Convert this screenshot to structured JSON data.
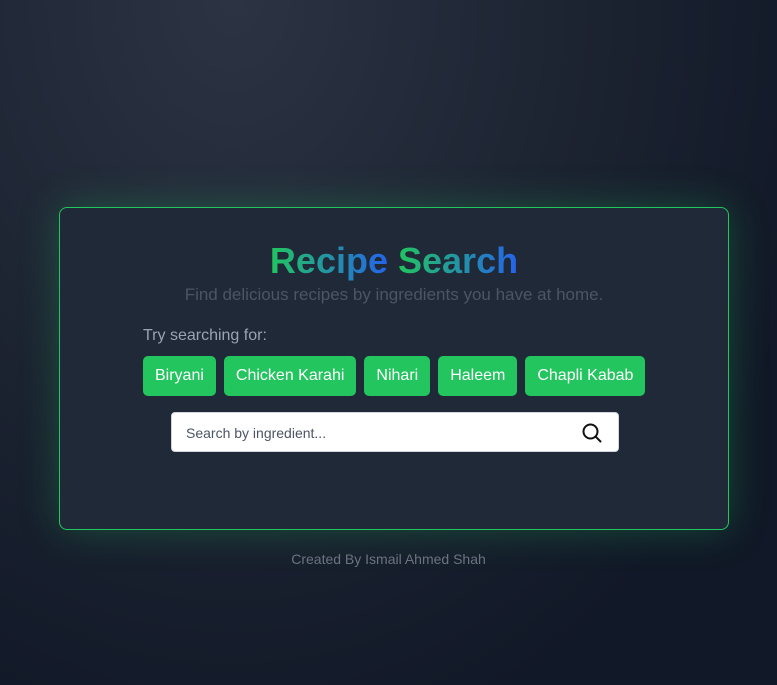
{
  "app": {
    "title_part1": "Recipe",
    "title_part2": "Search",
    "subtitle": "Find delicious recipes by ingredients you have at home."
  },
  "suggestions": {
    "label": "Try searching for:",
    "items": [
      "Biryani",
      "Chicken Karahi",
      "Nihari",
      "Haleem",
      "Chapli Kabab"
    ]
  },
  "search": {
    "value": "",
    "placeholder": "Search by ingredient...",
    "icon": "search-icon"
  },
  "footer": {
    "text": "Created By Ismail Ahmed Shah"
  },
  "colors": {
    "accent": "#22c55e",
    "gradient_end": "#2563eb",
    "card_bg": "#1f2937",
    "page_bg": "#111827"
  }
}
